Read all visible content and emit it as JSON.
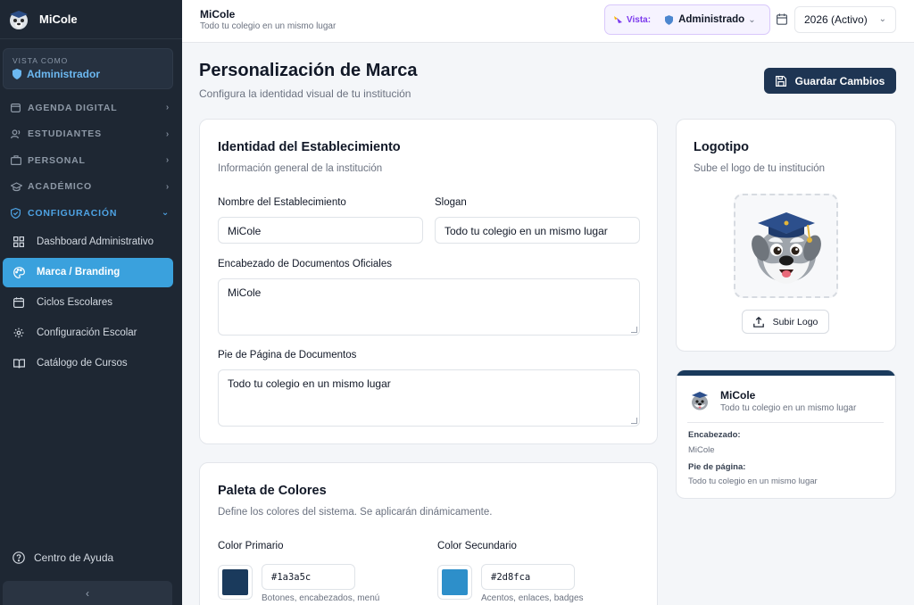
{
  "app": {
    "name": "MiCole"
  },
  "sidebar": {
    "view_as_label": "VISTA COMO",
    "view_as_role": "Administrador",
    "sections": [
      {
        "label": "AGENDA DIGITAL"
      },
      {
        "label": "ESTUDIANTES"
      },
      {
        "label": "PERSONAL"
      },
      {
        "label": "ACADÉMICO"
      },
      {
        "label": "CONFIGURACIÓN"
      }
    ],
    "sub_items": [
      {
        "label": "Dashboard Administrativo"
      },
      {
        "label": "Marca / Branding"
      },
      {
        "label": "Ciclos Escolares"
      },
      {
        "label": "Configuración Escolar"
      },
      {
        "label": "Catálogo de Cursos"
      }
    ],
    "help_label": "Centro de Ayuda",
    "collapse_glyph": "‹"
  },
  "topbar": {
    "title": "MiCole",
    "subtitle": "Todo tu colegio en un mismo lugar",
    "vista_label": "Vista:",
    "vista_value": "Administrado",
    "year": "2026 (Activo)"
  },
  "header": {
    "title": "Personalización de Marca",
    "subtitle": "Configura la identidad visual de tu institución",
    "save_label": "Guardar Cambios"
  },
  "identity": {
    "title": "Identidad del Establecimiento",
    "subtitle": "Información general de la institución",
    "name_label": "Nombre del Establecimiento",
    "name_value": "MiCole",
    "slogan_label": "Slogan",
    "slogan_value": "Todo tu colegio en un mismo lugar",
    "header_label": "Encabezado de Documentos Oficiales",
    "header_value": "MiCole",
    "footer_label": "Pie de Página de Documentos",
    "footer_value": "Todo tu colegio en un mismo lugar"
  },
  "logo": {
    "title": "Logotipo",
    "subtitle": "Sube el logo de tu institución",
    "upload_label": "Subir Logo"
  },
  "preview": {
    "name": "MiCole",
    "slogan": "Todo tu colegio en un mismo lugar",
    "header_key": "Encabezado:",
    "header_value": "MiCole",
    "footer_key": "Pie de página:",
    "footer_value": "Todo tu colegio en un mismo lugar"
  },
  "palette": {
    "title": "Paleta de Colores",
    "subtitle": "Define los colores del sistema. Se aplicarán dinámicamente.",
    "primary_label": "Color Primario",
    "primary_hex": "#1a3a5c",
    "primary_hint": "Botones, encabezados, menú",
    "secondary_label": "Color Secundario",
    "secondary_hex": "#2d8fca",
    "secondary_hint": "Acentos, enlaces, badges"
  },
  "colors": {
    "sidebar_bg": "#1e2733",
    "active_item": "#3aa1dd",
    "save_button": "#1e3553"
  }
}
